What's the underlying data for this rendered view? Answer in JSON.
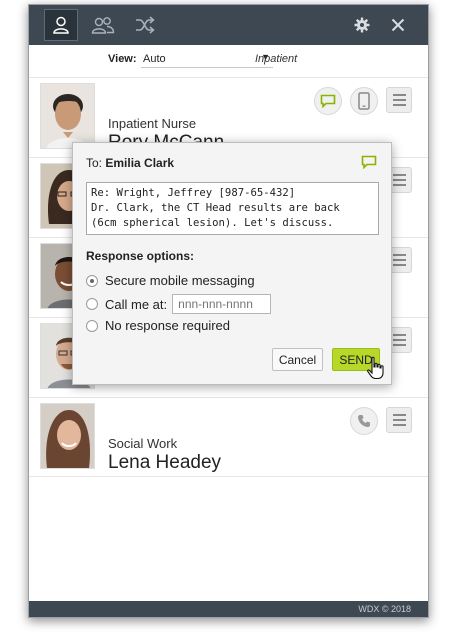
{
  "titlebar": {
    "tabs": [
      {
        "icon": "person-icon",
        "active": true
      },
      {
        "icon": "group-icon",
        "active": false
      },
      {
        "icon": "shuffle-icon",
        "active": false
      }
    ],
    "settings_icon": "gear-icon",
    "close_icon": "close-icon"
  },
  "viewbar": {
    "label": "View:",
    "selected": "Auto",
    "arrow": "▼",
    "scope": "Inpatient"
  },
  "contacts": [
    {
      "role": "Inpatient Nurse",
      "name": "Rory McCann",
      "actions": [
        "message-icon",
        "mobile-icon",
        "menu-icon"
      ]
    },
    {
      "role": "",
      "name": "",
      "actions": [
        "menu-icon"
      ]
    },
    {
      "role": "",
      "name": "",
      "actions": [
        "menu-icon"
      ]
    },
    {
      "role": "",
      "name": "",
      "actions": [
        "menu-icon"
      ]
    },
    {
      "role": "Social Work",
      "name": "Lena Headey",
      "actions": [
        "phone-icon",
        "menu-icon"
      ]
    }
  ],
  "dialog": {
    "to_label": "To:",
    "to_name": "Emilia Clark",
    "message": "Re: Wright, Jeffrey [987-65-432]\nDr. Clark, the CT Head results are back\n(6cm spherical lesion). Let's discuss.",
    "response_label": "Response options:",
    "options": [
      {
        "label": "Secure mobile messaging",
        "checked": true
      },
      {
        "label": "Call me at:",
        "checked": false
      },
      {
        "label": "No response required",
        "checked": false
      }
    ],
    "phone_placeholder": "nnn-nnn-nnnn",
    "cancel_label": "Cancel",
    "send_label": "SEND"
  },
  "footer": {
    "copyright": "WDX © 2018"
  },
  "colors": {
    "titlebar": "#3e4852",
    "accent_green": "#8ab300",
    "send_button": "#b8d829"
  }
}
